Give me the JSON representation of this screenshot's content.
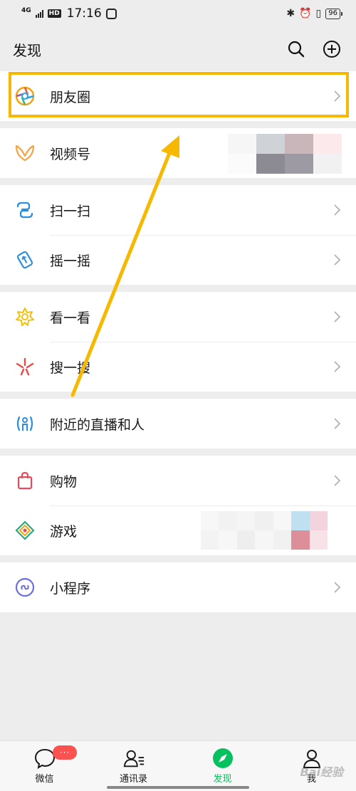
{
  "status_bar": {
    "network": "4G",
    "hd": "HD",
    "time": "17:16",
    "battery": "96"
  },
  "header": {
    "title": "发现",
    "search_icon": "search-icon",
    "add_icon": "plus-circle-icon"
  },
  "groups": [
    [
      {
        "label": "朋友圈",
        "icon": "moments-icon",
        "chevron": true
      }
    ],
    [
      {
        "label": "视频号",
        "icon": "channels-icon",
        "chevron": false
      }
    ],
    [
      {
        "label": "扫一扫",
        "icon": "scan-icon",
        "chevron": true
      },
      {
        "label": "摇一摇",
        "icon": "shake-icon",
        "chevron": true
      }
    ],
    [
      {
        "label": "看一看",
        "icon": "top-stories-icon",
        "chevron": true
      },
      {
        "label": "搜一搜",
        "icon": "search-spark-icon",
        "chevron": true
      }
    ],
    [
      {
        "label": "附近的直播和人",
        "icon": "nearby-icon",
        "chevron": true
      }
    ],
    [
      {
        "label": "购物",
        "icon": "shopping-bag-icon",
        "chevron": true
      },
      {
        "label": "游戏",
        "icon": "games-icon",
        "chevron": false
      }
    ],
    [
      {
        "label": "小程序",
        "icon": "mini-program-icon",
        "chevron": true
      }
    ]
  ],
  "tabbar": {
    "items": [
      {
        "label": "微信",
        "icon": "chats-icon",
        "badge": "···"
      },
      {
        "label": "通讯录",
        "icon": "contacts-icon"
      },
      {
        "label": "发现",
        "icon": "discover-icon",
        "active": true
      },
      {
        "label": "我",
        "icon": "me-icon"
      }
    ]
  },
  "annotation": {
    "highlight_color": "#f6b900",
    "arrow_color": "#f6b900"
  },
  "colors": {
    "accent": "#07c160",
    "badge": "#fa5151",
    "background": "#ededed"
  },
  "watermark": "Bai经验"
}
